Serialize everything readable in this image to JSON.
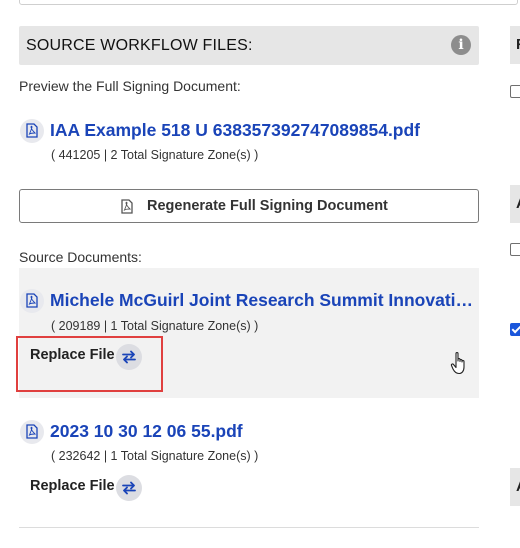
{
  "section": {
    "title": "SOURCE WORKFLOW FILES:",
    "info_icon": "info-icon"
  },
  "preview": {
    "label": "Preview the Full Signing Document:",
    "file_name": "IAA Example 518 U 638357392747089854.pdf",
    "file_meta": "( 441205 | 2 Total Signature Zone(s) )"
  },
  "regenerate_button": {
    "label": "Regenerate Full Signing Document",
    "icon": "pdf-file-icon"
  },
  "source_documents": {
    "label": "Source Documents:",
    "items": [
      {
        "file_name": "Michele McGuirl Joint Research Summit Innovation",
        "file_meta": "( 209189 | 1 Total Signature Zone(s) )",
        "replace_label": "Replace File",
        "highlighted": true
      },
      {
        "file_name": "2023 10 30 12 06 55.pdf",
        "file_meta": "( 232642 | 1 Total Signature Zone(s) )",
        "replace_label": "Replace File",
        "highlighted": false
      }
    ]
  },
  "right_column": {
    "header_letters": [
      "F",
      "A",
      "A"
    ],
    "checkboxes": [
      false,
      false,
      true
    ]
  },
  "colors": {
    "link": "#1a44b8",
    "header_bg": "#e6e6e6",
    "highlight": "#e0403f",
    "card_bg": "#f2f2f2"
  }
}
